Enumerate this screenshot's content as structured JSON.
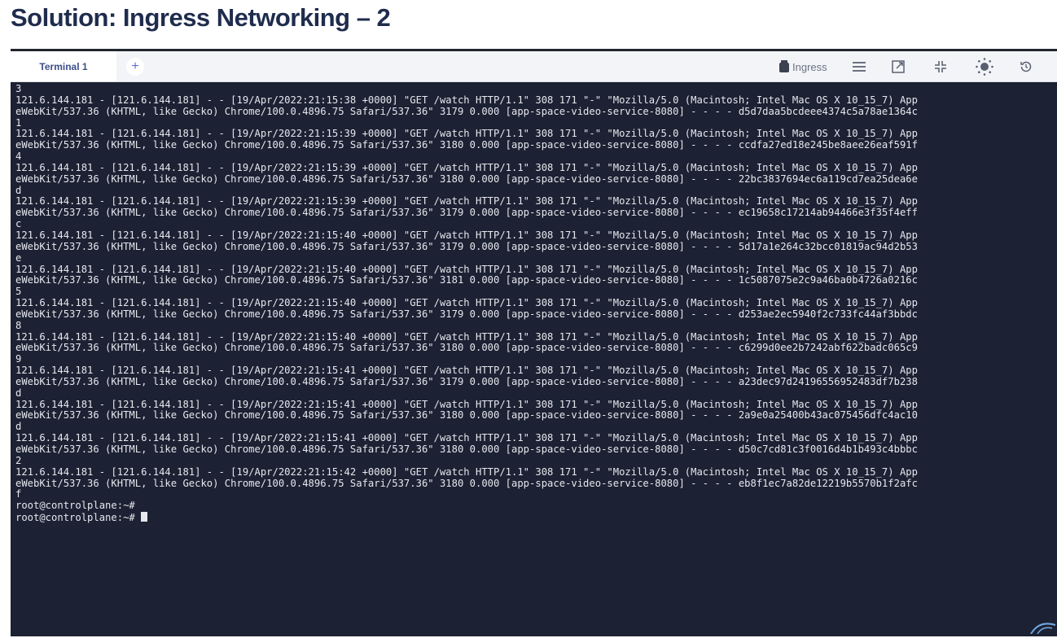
{
  "slide": {
    "title": "Solution: Ingress Networking – 2"
  },
  "tabbar": {
    "tab_label": "Terminal 1",
    "add_label": "+",
    "context_label": "Ingress",
    "icons": [
      "ingress-icon",
      "menu-icon",
      "external-link-icon",
      "compress-icon",
      "brightness-icon",
      "history-icon"
    ]
  },
  "terminal": {
    "lines": [
      "3",
      "121.6.144.181 - [121.6.144.181] - - [19/Apr/2022:21:15:38 +0000] \"GET /watch HTTP/1.1\" 308 171 \"-\" \"Mozilla/5.0 (Macintosh; Intel Mac OS X 10_15_7) App",
      "eWebKit/537.36 (KHTML, like Gecko) Chrome/100.0.4896.75 Safari/537.36\" 3179 0.000 [app-space-video-service-8080] - - - - d5d7daa5bcdeee4374c5a78ae1364c",
      "1",
      "121.6.144.181 - [121.6.144.181] - - [19/Apr/2022:21:15:39 +0000] \"GET /watch HTTP/1.1\" 308 171 \"-\" \"Mozilla/5.0 (Macintosh; Intel Mac OS X 10_15_7) App",
      "eWebKit/537.36 (KHTML, like Gecko) Chrome/100.0.4896.75 Safari/537.36\" 3180 0.000 [app-space-video-service-8080] - - - - ccdfa27ed18e245be8aee26eaf591f",
      "4",
      "121.6.144.181 - [121.6.144.181] - - [19/Apr/2022:21:15:39 +0000] \"GET /watch HTTP/1.1\" 308 171 \"-\" \"Mozilla/5.0 (Macintosh; Intel Mac OS X 10_15_7) App",
      "eWebKit/537.36 (KHTML, like Gecko) Chrome/100.0.4896.75 Safari/537.36\" 3180 0.000 [app-space-video-service-8080] - - - - 22bc3837694ec6a119cd7ea25dea6e",
      "d",
      "121.6.144.181 - [121.6.144.181] - - [19/Apr/2022:21:15:39 +0000] \"GET /watch HTTP/1.1\" 308 171 \"-\" \"Mozilla/5.0 (Macintosh; Intel Mac OS X 10_15_7) App",
      "eWebKit/537.36 (KHTML, like Gecko) Chrome/100.0.4896.75 Safari/537.36\" 3179 0.000 [app-space-video-service-8080] - - - - ec19658c17214ab94466e3f35f4eff",
      "c",
      "121.6.144.181 - [121.6.144.181] - - [19/Apr/2022:21:15:40 +0000] \"GET /watch HTTP/1.1\" 308 171 \"-\" \"Mozilla/5.0 (Macintosh; Intel Mac OS X 10_15_7) App",
      "eWebKit/537.36 (KHTML, like Gecko) Chrome/100.0.4896.75 Safari/537.36\" 3179 0.000 [app-space-video-service-8080] - - - - 5d17a1e264c32bcc01819ac94d2b53",
      "e",
      "121.6.144.181 - [121.6.144.181] - - [19/Apr/2022:21:15:40 +0000] \"GET /watch HTTP/1.1\" 308 171 \"-\" \"Mozilla/5.0 (Macintosh; Intel Mac OS X 10_15_7) App",
      "eWebKit/537.36 (KHTML, like Gecko) Chrome/100.0.4896.75 Safari/537.36\" 3181 0.000 [app-space-video-service-8080] - - - - 1c5087075e2c9a46ba0b4726a0216c",
      "5",
      "121.6.144.181 - [121.6.144.181] - - [19/Apr/2022:21:15:40 +0000] \"GET /watch HTTP/1.1\" 308 171 \"-\" \"Mozilla/5.0 (Macintosh; Intel Mac OS X 10_15_7) App",
      "eWebKit/537.36 (KHTML, like Gecko) Chrome/100.0.4896.75 Safari/537.36\" 3179 0.000 [app-space-video-service-8080] - - - - d253ae2ec5940f2c733fc44af3bbdc",
      "8",
      "121.6.144.181 - [121.6.144.181] - - [19/Apr/2022:21:15:40 +0000] \"GET /watch HTTP/1.1\" 308 171 \"-\" \"Mozilla/5.0 (Macintosh; Intel Mac OS X 10_15_7) App",
      "eWebKit/537.36 (KHTML, like Gecko) Chrome/100.0.4896.75 Safari/537.36\" 3180 0.000 [app-space-video-service-8080] - - - - c6299d0ee2b7242abf622badc065c9",
      "9",
      "121.6.144.181 - [121.6.144.181] - - [19/Apr/2022:21:15:41 +0000] \"GET /watch HTTP/1.1\" 308 171 \"-\" \"Mozilla/5.0 (Macintosh; Intel Mac OS X 10_15_7) App",
      "eWebKit/537.36 (KHTML, like Gecko) Chrome/100.0.4896.75 Safari/537.36\" 3179 0.000 [app-space-video-service-8080] - - - - a23dec97d24196556952483df7b238",
      "d",
      "121.6.144.181 - [121.6.144.181] - - [19/Apr/2022:21:15:41 +0000] \"GET /watch HTTP/1.1\" 308 171 \"-\" \"Mozilla/5.0 (Macintosh; Intel Mac OS X 10_15_7) App",
      "eWebKit/537.36 (KHTML, like Gecko) Chrome/100.0.4896.75 Safari/537.36\" 3180 0.000 [app-space-video-service-8080] - - - - 2a9e0a25400b43ac075456dfc4ac10",
      "d",
      "121.6.144.181 - [121.6.144.181] - - [19/Apr/2022:21:15:41 +0000] \"GET /watch HTTP/1.1\" 308 171 \"-\" \"Mozilla/5.0 (Macintosh; Intel Mac OS X 10_15_7) App",
      "eWebKit/537.36 (KHTML, like Gecko) Chrome/100.0.4896.75 Safari/537.36\" 3180 0.000 [app-space-video-service-8080] - - - - d50c7cd81c3f0016d4b1b493c4bbbc",
      "2",
      "121.6.144.181 - [121.6.144.181] - - [19/Apr/2022:21:15:42 +0000] \"GET /watch HTTP/1.1\" 308 171 \"-\" \"Mozilla/5.0 (Macintosh; Intel Mac OS X 10_15_7) App",
      "eWebKit/537.36 (KHTML, like Gecko) Chrome/100.0.4896.75 Safari/537.36\" 3180 0.000 [app-space-video-service-8080] - - - - eb8f1ec7a82de12219b5570b1f2afc",
      "f",
      "root@controlplane:~#"
    ],
    "prompt": "root@controlplane:~# "
  },
  "colors": {
    "title": "#1f2c4d",
    "terminal_bg": "#1c2133",
    "terminal_text": "#e6e8ee",
    "tab_text": "#3d4f8a",
    "accent": "#5b6fd6"
  }
}
